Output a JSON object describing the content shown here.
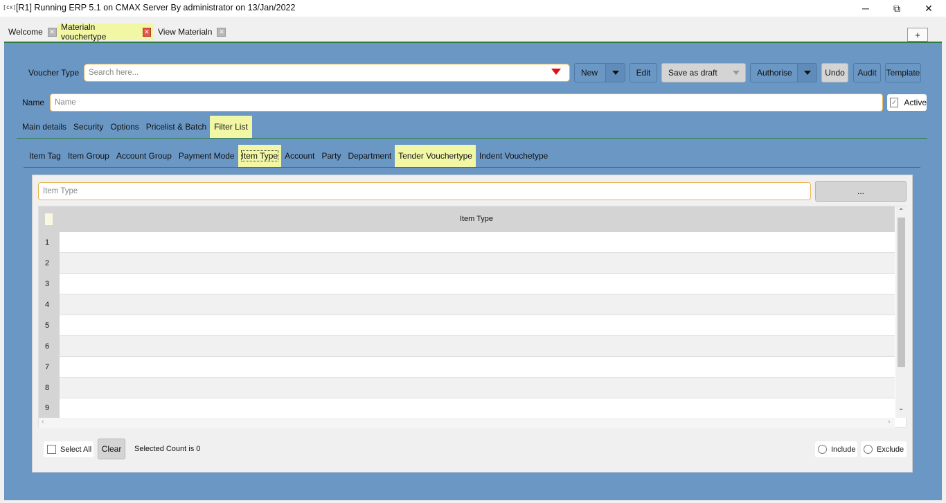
{
  "window": {
    "app_icon": "[cx]",
    "title": "[R1] Running ERP 5.1 on CMAX Server By administrator on 13/Jan/2022",
    "minimize": "─",
    "maximize": "⧉",
    "close": "✕"
  },
  "doc_tabs": [
    {
      "label": "Welcome",
      "active": false
    },
    {
      "label": "Materialn vouchertype",
      "active": true
    },
    {
      "label": "View Materialn",
      "active": false
    }
  ],
  "add_tab_label": "+",
  "toolbar": {
    "voucher_type_label": "Voucher Type",
    "search_placeholder": "Search here...",
    "new_label": "New",
    "edit_label": "Edit",
    "save_draft_label": "Save as draft",
    "authorise_label": "Authorise",
    "undo_label": "Undo",
    "audit_label": "Audit",
    "template_label": "Template"
  },
  "name_row": {
    "name_label": "Name",
    "name_placeholder": "Name",
    "active_label": "Active",
    "active_checked": true
  },
  "main_tabs": [
    {
      "label": "Main details",
      "active": false
    },
    {
      "label": "Security",
      "active": false
    },
    {
      "label": "Options",
      "active": false
    },
    {
      "label": "Pricelist & Batch",
      "active": false
    },
    {
      "label": "Filter List",
      "active": true
    }
  ],
  "filter_tabs": [
    {
      "label": "Item Tag",
      "active": false
    },
    {
      "label": "Item Group",
      "active": false
    },
    {
      "label": "Account Group",
      "active": false
    },
    {
      "label": "Payment Mode",
      "active": false
    },
    {
      "label": "Item Type",
      "active": true,
      "focused": true
    },
    {
      "label": "Account",
      "active": false
    },
    {
      "label": "Party",
      "active": false
    },
    {
      "label": "Department",
      "active": false
    },
    {
      "label": "Tender Vouchertype",
      "active": true
    },
    {
      "label": "Indent Vouchetype",
      "active": false
    }
  ],
  "filter_panel": {
    "item_type_placeholder": "Item Type",
    "browse_label": "...",
    "grid_header": "Item Type",
    "rows": [
      "1",
      "2",
      "3",
      "4",
      "5",
      "6",
      "7",
      "8",
      "9"
    ],
    "select_all_label": "Select All",
    "clear_label": "Clear",
    "selected_count": "Selected Count is 0",
    "include_label": "Include",
    "exclude_label": "Exclude"
  },
  "colors": {
    "panel_blue": "#6a97c4",
    "active_tab_yellow": "#f2f7a6",
    "accent_green": "#2e7a40",
    "input_border_orange": "#e8b352",
    "dropdown_red": "#e01010"
  }
}
